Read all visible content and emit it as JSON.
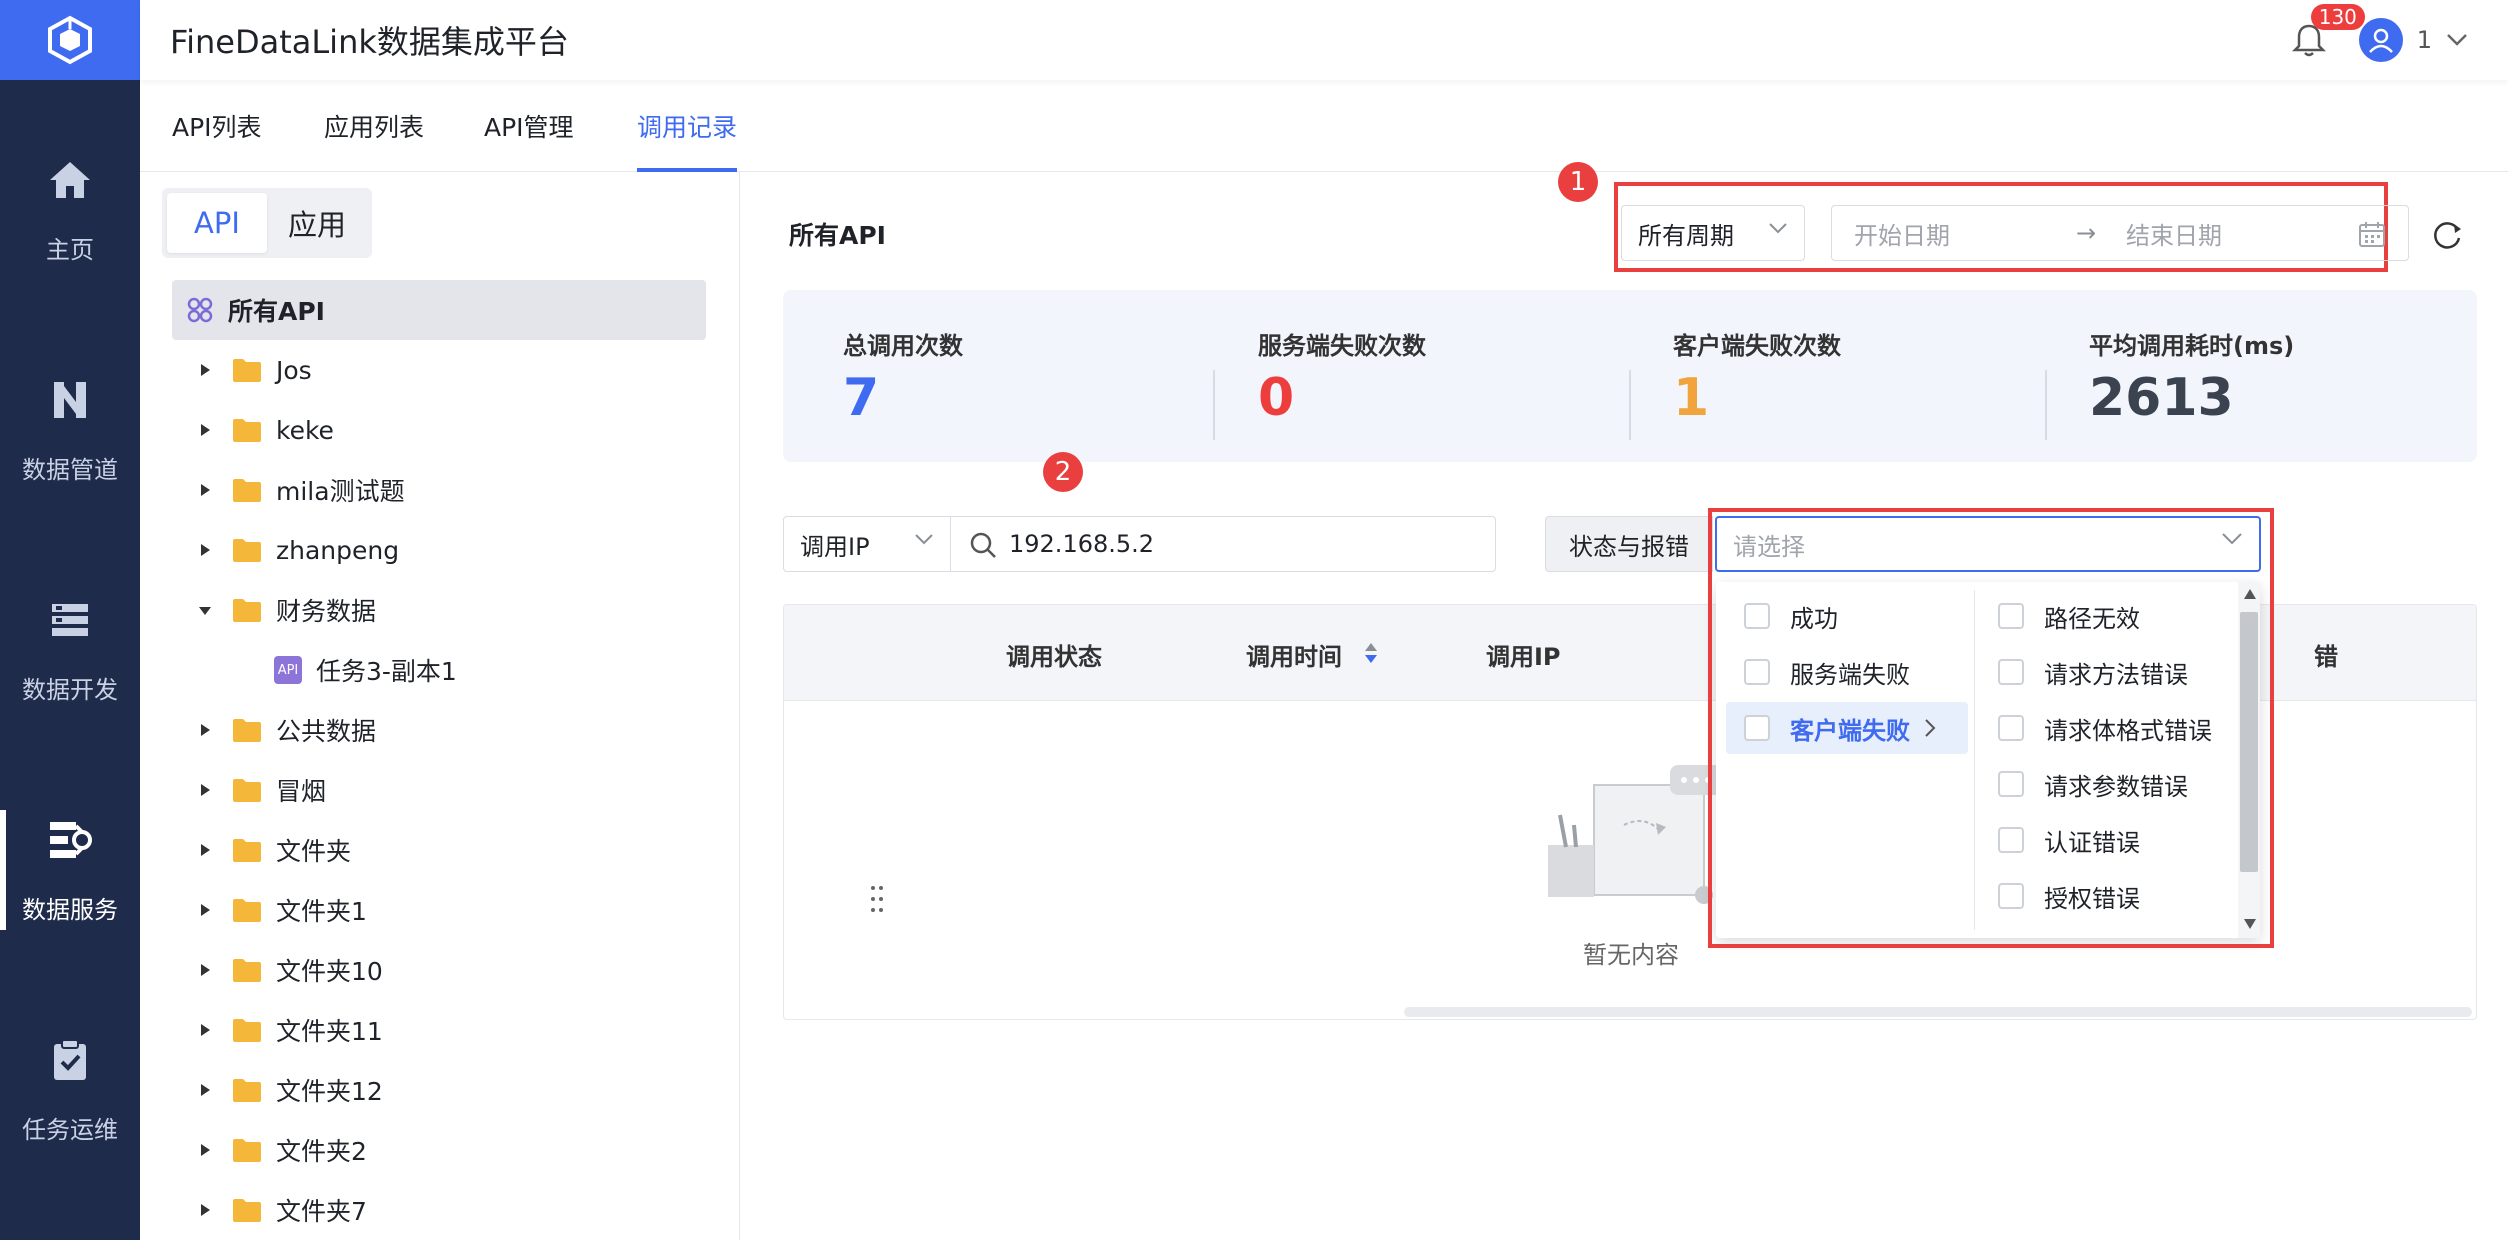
{
  "header": {
    "app_title": "FineDataLink数据集成平台",
    "notification_count": "130",
    "user_name": "1"
  },
  "nav": [
    {
      "label": "主页",
      "icon": "home-icon"
    },
    {
      "label": "数据管道",
      "icon": "pipeline-icon"
    },
    {
      "label": "数据开发",
      "icon": "dev-icon"
    },
    {
      "label": "数据服务",
      "icon": "data-service-icon"
    },
    {
      "label": "任务运维",
      "icon": "task-ops-icon"
    }
  ],
  "tabs": [
    "API列表",
    "应用列表",
    "API管理",
    "调用记录"
  ],
  "tree": {
    "segment": [
      "API",
      "应用"
    ],
    "all_label": "所有API",
    "items": [
      {
        "label": "Jos"
      },
      {
        "label": "keke"
      },
      {
        "label": "mila测试题"
      },
      {
        "label": "zhanpeng"
      },
      {
        "label": "财务数据"
      },
      {
        "label": "任务3-副本1"
      },
      {
        "label": "公共数据"
      },
      {
        "label": "冒烟"
      },
      {
        "label": "文件夹"
      },
      {
        "label": "文件夹1"
      },
      {
        "label": "文件夹10"
      },
      {
        "label": "文件夹11"
      },
      {
        "label": "文件夹12"
      },
      {
        "label": "文件夹2"
      },
      {
        "label": "文件夹7"
      }
    ],
    "api_tag": "API"
  },
  "main": {
    "title": "所有API",
    "period_value": "所有周期",
    "start_date_placeholder": "开始日期",
    "end_date_placeholder": "结束日期",
    "range_arrow": "→",
    "badge_1": "1",
    "badge_2": "2"
  },
  "stats": [
    {
      "label": "总调用次数",
      "value": "7",
      "color": "#3f6bf0"
    },
    {
      "label": "服务端失败次数",
      "value": "0",
      "color": "#ee3d3d"
    },
    {
      "label": "客户端失败次数",
      "value": "1",
      "color": "#f0a43b"
    },
    {
      "label": "平均调用耗时(ms)",
      "value": "2613",
      "color": "#3c4350"
    }
  ],
  "filters": {
    "ip_select": "调用IP",
    "ip_value": "192.168.5.2",
    "status_label": "状态与报错",
    "status_placeholder": "请选择"
  },
  "table": {
    "columns": [
      "调用状态",
      "调用时间",
      "调用IP",
      "错"
    ],
    "empty_text": "暂无内容"
  },
  "dropdown": {
    "left": [
      "成功",
      "服务端失败",
      "客户端失败"
    ],
    "right": [
      "路径无效",
      "请求方法错误",
      "请求体格式错误",
      "请求参数错误",
      "认证错误",
      "授权错误"
    ]
  }
}
